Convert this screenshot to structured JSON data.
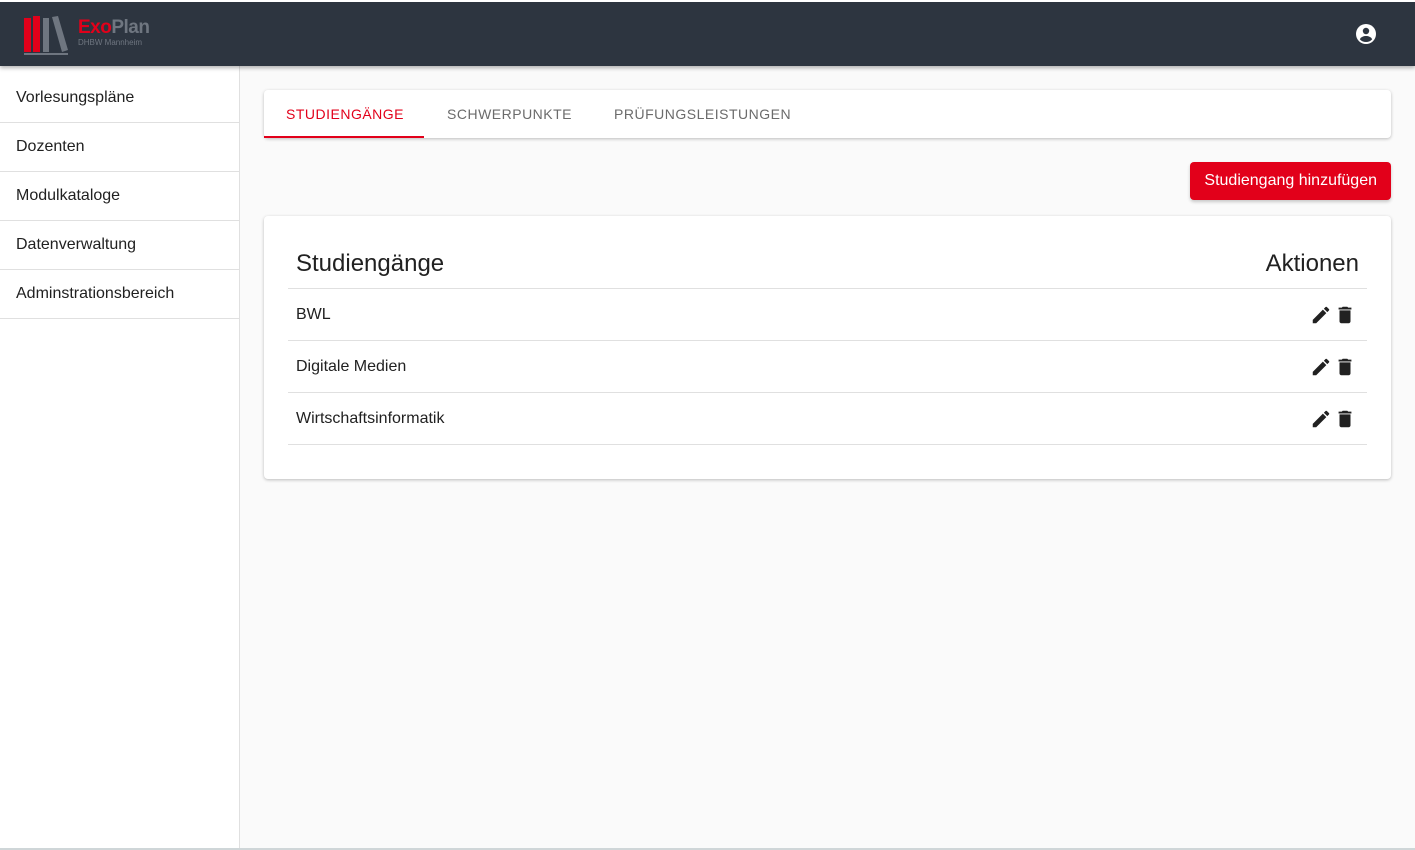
{
  "brand": {
    "title_part1": "Exo",
    "title_part2": "Plan",
    "subtitle": "DHBW Mannheim",
    "accent_color": "#e2001a",
    "topbar_color": "#2d3540"
  },
  "header": {
    "account_icon": "account-circle-icon"
  },
  "sidebar": {
    "items": [
      {
        "label": "Vorlesungspläne"
      },
      {
        "label": "Dozenten"
      },
      {
        "label": "Modulkataloge"
      },
      {
        "label": "Datenverwaltung"
      },
      {
        "label": "Adminstrationsbereich"
      }
    ]
  },
  "tabs": [
    {
      "label": "STUDIENGÄNGE",
      "active": true
    },
    {
      "label": "SCHWERPUNKTE",
      "active": false
    },
    {
      "label": "PRÜFUNGSLEISTUNGEN",
      "active": false
    }
  ],
  "toolbar": {
    "add_label": "Studiengang hinzufügen"
  },
  "table": {
    "headers": {
      "name": "Studiengänge",
      "actions": "Aktionen"
    },
    "rows": [
      {
        "name": "BWL",
        "edit_icon": "pencil-icon",
        "delete_icon": "trash-icon"
      },
      {
        "name": "Digitale Medien",
        "edit_icon": "pencil-icon",
        "delete_icon": "trash-icon"
      },
      {
        "name": "Wirtschaftsinformatik",
        "edit_icon": "pencil-icon",
        "delete_icon": "trash-icon"
      }
    ]
  }
}
